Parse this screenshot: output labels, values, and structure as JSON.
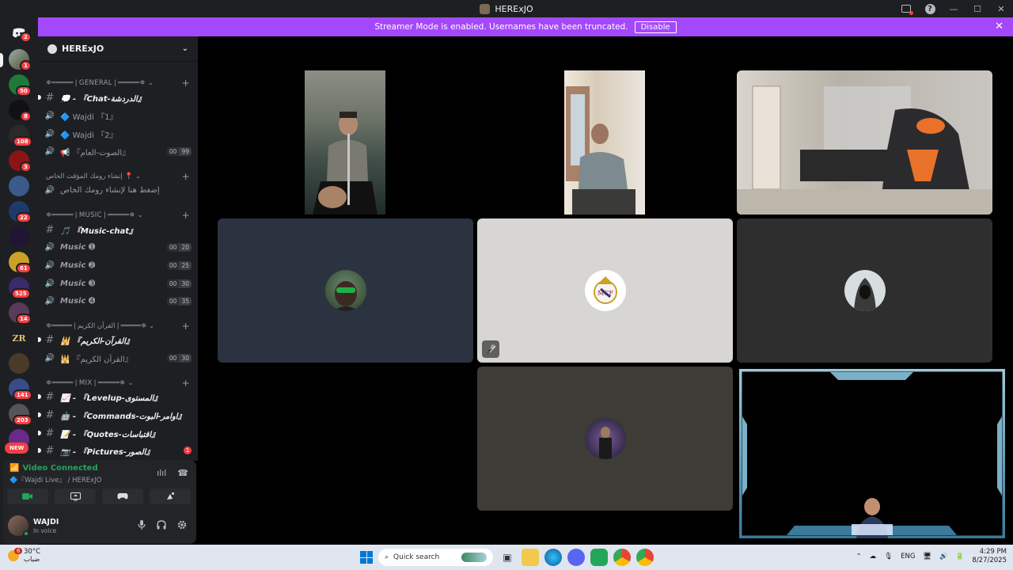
{
  "window": {
    "title": "HERExJO",
    "help": "?",
    "minimize": "—",
    "maximize": "☐",
    "close": "✕"
  },
  "banner": {
    "text": "Streamer Mode is enabled. Usernames have been truncated.",
    "button": "Disable",
    "close": "✕"
  },
  "servers": {
    "home_badge": "2",
    "badges": [
      "1",
      "50",
      "8",
      "108",
      "3",
      "22",
      "61",
      "525",
      "14",
      "141",
      "203"
    ],
    "zr_label": "ZR",
    "new_label": "NEW"
  },
  "guild": {
    "name": "HERExJO",
    "chevron": "⌄",
    "plus": "+"
  },
  "channels": {
    "cat_general": "✵═════❘GENERAL❘═════✵ ⌄",
    "chat": "💭 - 『Chat-الدردشة』",
    "wajdi1": "🔷 Wajdi 『1』",
    "wajdi2": "🔷 Wajdi 『2』",
    "general_voice": "📢 『الصوت-العام』",
    "general_voice_limits": [
      "00",
      "99"
    ],
    "cat_create": "إنشاء رومك المؤقت الخاص 📍 ⌄",
    "create_room": "إضغط هنا لإنشاء رومك الخاص",
    "cat_music": "✵═════❘MUSIC❘═════✵ ⌄",
    "music_chat": "🎵 『Music-chat』",
    "music": [
      {
        "name": "Music ➊",
        "limits": [
          "00",
          "20"
        ]
      },
      {
        "name": "Music ➋",
        "limits": [
          "00",
          "25"
        ]
      },
      {
        "name": "Music ➌",
        "limits": [
          "00",
          "30"
        ]
      },
      {
        "name": "Music ➍",
        "limits": [
          "00",
          "35"
        ]
      }
    ],
    "cat_quran": "✵═════❘القرآن الكريم❘═════✵ ⌄",
    "quran_text": "🕌 『القرآن-الكريم』",
    "quran_voice": "🕌 『القرآن الكريم』",
    "quran_voice_limits": [
      "00",
      "30"
    ],
    "cat_mix": "✵═════❘MIX❘═════✵ ⌄",
    "levelup": "📈 - 『Levelup-المستوى』",
    "commands": "🤖 - 『Commands-اوامر-البوت』",
    "quotes": "📝 - 『Quotes-اقتباسات』",
    "pictures": "📷 - 『Pictures-الصور』",
    "pictures_unread": "1"
  },
  "voice_panel": {
    "status": "Video Connected",
    "location": "🔷『Wajdi Live』 / HERExJO",
    "icon_soundboard": "ılıl",
    "icon_disconnect": "☎"
  },
  "user_panel": {
    "name": "WAJDI",
    "status": "In voice"
  },
  "taskbar": {
    "weather_badge": "6",
    "temperature": "30°C",
    "weather_desc": "ضباب",
    "search_placeholder": "Quick search",
    "lang": "ENG",
    "time": "4:29 PM",
    "date": "8/27/2025"
  },
  "colors": {
    "banner": "#a448fb",
    "server_rail": "#1e1f22",
    "voice_connected": "#23a55a",
    "badge": "#f23f43",
    "tile_navy": "#2b3340",
    "tile_light": "#d8d6d2",
    "tile_dark": "#2e2e2e",
    "tile_olive": "#3d3c37"
  }
}
